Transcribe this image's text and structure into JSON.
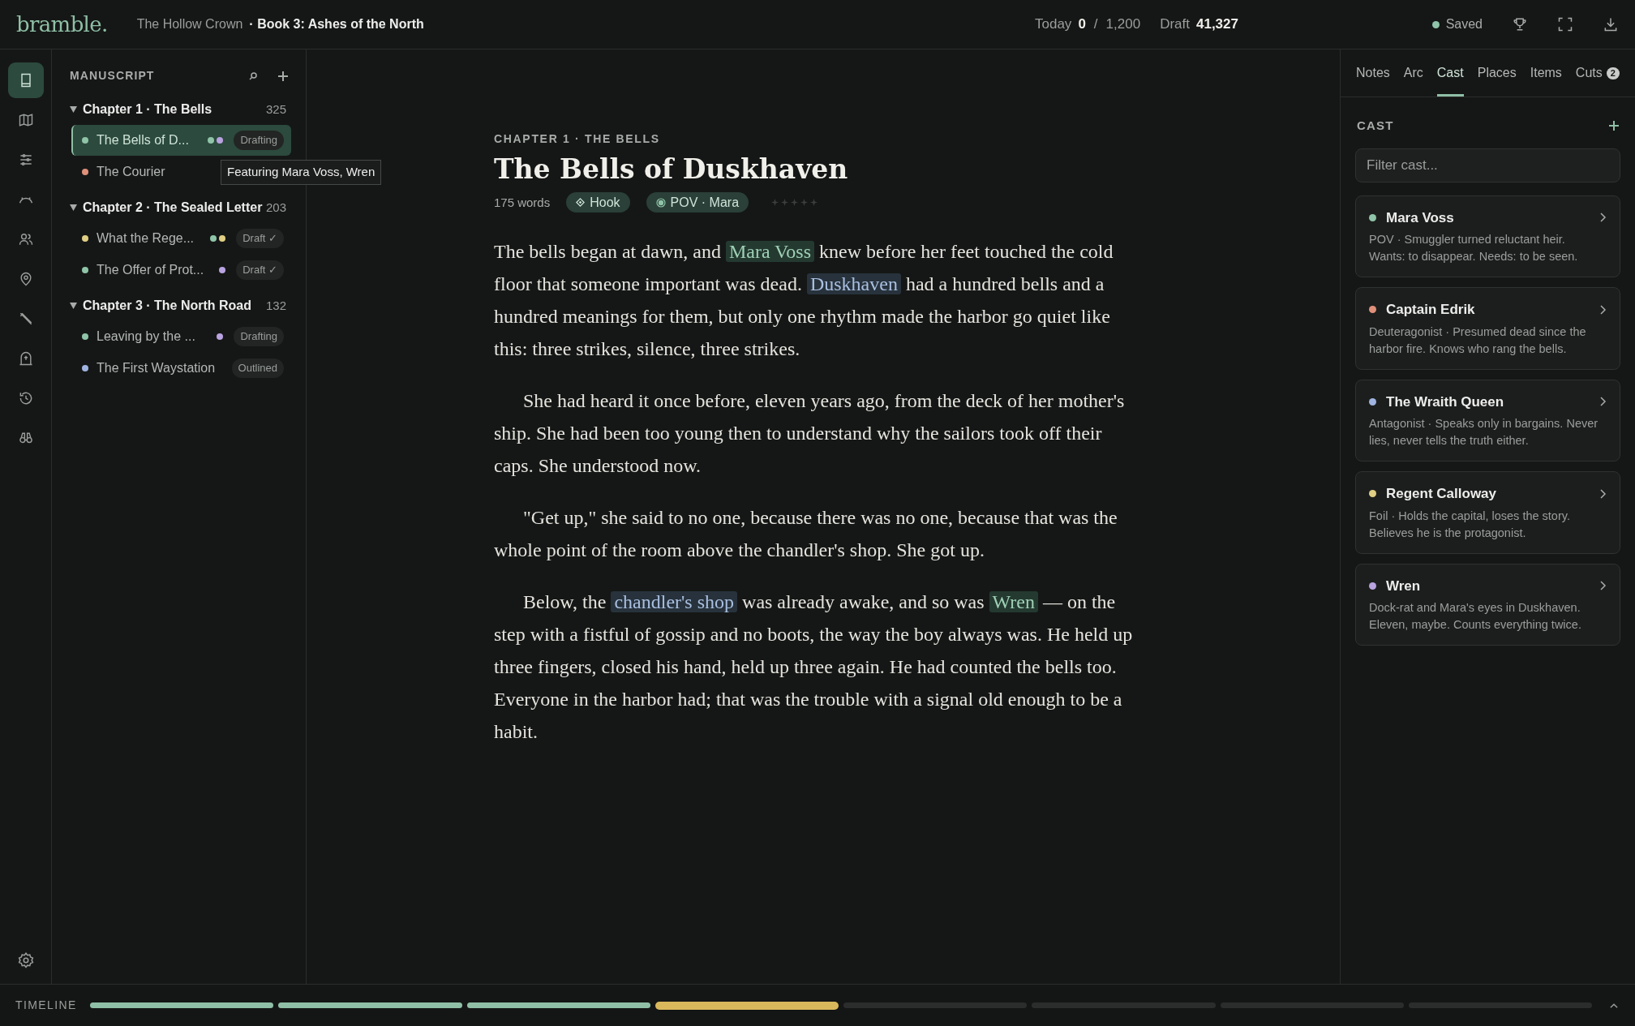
{
  "app": {
    "logo": "bramble.",
    "series": "The Hollow Crown",
    "book": "· Book 3: Ashes of the North"
  },
  "stats": {
    "today_label": "Today",
    "today": "0",
    "separator": "/",
    "goal": "1,200",
    "draft_label": "Draft",
    "draft": "41,327"
  },
  "save_status": {
    "label": "Saved"
  },
  "rail": [
    {
      "kind": "book",
      "selected": true
    },
    {
      "kind": "map",
      "selected": false
    },
    {
      "kind": "sliders",
      "selected": false
    },
    {
      "kind": "arc",
      "selected": false
    },
    {
      "kind": "people",
      "selected": false
    },
    {
      "kind": "pin",
      "selected": false
    },
    {
      "kind": "pen",
      "selected": false
    },
    {
      "kind": "stone",
      "selected": false
    },
    {
      "kind": "history",
      "selected": false
    },
    {
      "kind": "binoculars",
      "selected": false
    }
  ],
  "manuscript": {
    "title": "MANUSCRIPT",
    "chapters": [
      {
        "title": "Chapter 1 · The Bells",
        "count": "325",
        "expanded": true,
        "children": [
          {
            "title": "The Bells of D...",
            "color": "#8fc4a8",
            "cast": [
              {
                "color": "#8fc4a8"
              },
              {
                "color": "#b9a3e0"
              }
            ],
            "status": "Drafting",
            "selected": true
          },
          {
            "title": "The Courier",
            "color": "#e0907a",
            "selected": false
          }
        ]
      },
      {
        "title": "Chapter 2 · The Sealed Letter",
        "count": "203",
        "expanded": true,
        "children": [
          {
            "title": "What the Rege...",
            "color": "#e0cf84",
            "cast": [
              {
                "color": "#8fc4a8"
              },
              {
                "color": "#e0cf84"
              }
            ],
            "status": "Draft ✓",
            "selected": false
          },
          {
            "title": "The Offer of Prot...",
            "color": "#8fc4a8",
            "cast": [
              {
                "color": "#b9a3e0"
              }
            ],
            "status": "Draft ✓",
            "selected": false
          }
        ]
      },
      {
        "title": "Chapter 3 · The North Road",
        "count": "132",
        "expanded": true,
        "children": [
          {
            "title": "Leaving by the ...",
            "color": "#8fc4a8",
            "cast": [
              {
                "color": "#b9a3e0"
              }
            ],
            "status": "Drafting",
            "selected": false
          },
          {
            "title": "The First Waystation",
            "color": "#9fb4e0",
            "status": "Outlined",
            "selected": false
          }
        ]
      }
    ]
  },
  "tooltip": {
    "text": "Featuring Mara Voss, Wren"
  },
  "editor": {
    "chapter_label": "CHAPTER 1 · THE BELLS",
    "title": "The Bells of Duskhaven",
    "word_count": "175 words",
    "tags": [
      {
        "kind": "hook",
        "label": "Hook"
      },
      {
        "kind": "pov",
        "label": "POV · Mara"
      }
    ],
    "stars": 0,
    "paragraphs": [
      {
        "indent": false,
        "segments": [
          {
            "kind": "text",
            "text": "The bells began at dawn, and "
          },
          {
            "kind": "character",
            "text": "Mara Voss"
          },
          {
            "kind": "text",
            "text": " knew before her feet touched the cold floor that someone important was dead. "
          },
          {
            "kind": "place",
            "text": "Duskhaven"
          },
          {
            "kind": "text",
            "text": " had a hundred bells and a hundred meanings for them, but only one rhythm made the harbor go quiet like this: three strikes, silence, three strikes."
          }
        ]
      },
      {
        "indent": true,
        "segments": [
          {
            "kind": "text",
            "text": "She had heard it once before, eleven years ago, from the deck of her mother's ship. She had been too young then to understand why the sailors took off their caps. She understood now."
          }
        ]
      },
      {
        "indent": true,
        "segments": [
          {
            "kind": "text",
            "text": "\"Get up,\" she said to no one, because there was no one, because that was the whole point of the room above the chandler's shop. She got up."
          }
        ]
      },
      {
        "indent": true,
        "segments": [
          {
            "kind": "text",
            "text": "Below, the "
          },
          {
            "kind": "place",
            "text": "chandler's shop"
          },
          {
            "kind": "text",
            "text": " was already awake, and so was "
          },
          {
            "kind": "character",
            "text": "Wren"
          },
          {
            "kind": "text",
            "text": " — on the step with a fistful of gossip and no boots, the way the boy always was. He held up three fingers, closed his hand, held up three again. He had counted the bells too. Everyone in the harbor had; that was the trouble with a signal old enough to be a habit."
          }
        ]
      }
    ]
  },
  "side_tabs": [
    {
      "label": "Notes",
      "selected": false
    },
    {
      "label": "Arc",
      "selected": false
    },
    {
      "label": "Cast",
      "selected": true
    },
    {
      "label": "Places",
      "selected": false
    },
    {
      "label": "Items",
      "selected": false
    },
    {
      "label": "Cuts",
      "selected": false,
      "badge": "2"
    }
  ],
  "cast": {
    "title": "CAST",
    "filter": {
      "placeholder": "Filter cast..."
    },
    "items": [
      {
        "name": "Mara Voss",
        "color": "#8fc4a8",
        "description": "POV · Smuggler turned reluctant heir. Wants: to disappear. Needs: to be seen."
      },
      {
        "name": "Captain Edrik",
        "color": "#e0907a",
        "description": "Deuteragonist · Presumed dead since the harbor fire. Knows who rang the bells."
      },
      {
        "name": "The Wraith Queen",
        "color": "#9fb4e0",
        "description": "Antagonist · Speaks only in bargains. Never lies, never tells the truth either."
      },
      {
        "name": "Regent Calloway",
        "color": "#e0cf84",
        "description": "Foil · Holds the capital, loses the story. Believes he is the protagonist."
      },
      {
        "name": "Wren",
        "color": "#b9a3e0",
        "description": "Dock-rat and Mara's eyes in Duskhaven. Eleven, maybe. Counts everything twice."
      }
    ]
  },
  "timeline": {
    "label": "TIMELINE",
    "segments": [
      {
        "kind": "done"
      },
      {
        "kind": "done"
      },
      {
        "kind": "done"
      },
      {
        "kind": "current"
      },
      {
        "kind": "todo"
      },
      {
        "kind": "todo"
      },
      {
        "kind": "todo"
      },
      {
        "kind": "todo"
      }
    ]
  }
}
